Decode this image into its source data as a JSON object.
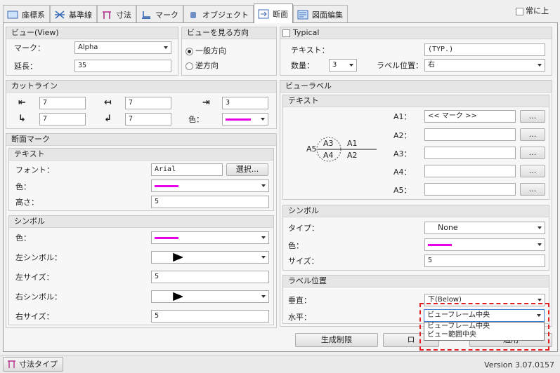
{
  "tabs": [
    {
      "label": "座標系",
      "icon": "coordinate-icon"
    },
    {
      "label": "基準線",
      "icon": "grid-icon"
    },
    {
      "label": "寸法",
      "icon": "dimension-icon"
    },
    {
      "label": "マーク",
      "icon": "mark-icon"
    },
    {
      "label": "オブジェクト",
      "icon": "object-icon"
    },
    {
      "label": "断面",
      "icon": "section-icon"
    },
    {
      "label": "図面編集",
      "icon": "drawing-edit-icon"
    }
  ],
  "always_on_top": "常に上",
  "view": {
    "title": "ビュー(View)",
    "mark_label": "マーク：",
    "mark_value": "Alpha",
    "extend_label": "延長：",
    "extend_value": "35"
  },
  "direction": {
    "title": "ビューを見る方向",
    "opt1": "一般方向",
    "opt2": "逆方向"
  },
  "typical": {
    "title": "Typical",
    "text_label": "テキスト：",
    "text_value": "(TYP.)",
    "qty_label": "数量：",
    "qty_value": "3",
    "pos_label": "ラベル位置：",
    "pos_value": "右"
  },
  "cutline": {
    "title": "カットライン",
    "v1": "7",
    "v2": "7",
    "v3": "3",
    "v4": "7",
    "v5": "7",
    "color_label": "色："
  },
  "section_mark": {
    "title": "断面マーク",
    "text_group": "テキスト",
    "font_label": "フォント：",
    "font_value": "Arial",
    "select_button": "選択...",
    "color_label": "色：",
    "height_label": "高さ：",
    "height_value": "5",
    "symbol_group": "シンボル",
    "sym_color_label": "色：",
    "left_symbol_label": "左シンボル：",
    "left_size_label": "左サイズ：",
    "left_size_value": "5",
    "right_symbol_label": "右シンボル：",
    "right_size_label": "右サイズ：",
    "right_size_value": "5"
  },
  "view_label": {
    "title": "ビューラベル",
    "text_group": "テキスト",
    "diagram": {
      "a5": "A5",
      "a3": "A3",
      "a4": "A4",
      "a1": "A1",
      "a2": "A2"
    },
    "rows": [
      {
        "label": "A1：",
        "value": "<< マーク >>",
        "button": "..."
      },
      {
        "label": "A2：",
        "value": "",
        "button": "..."
      },
      {
        "label": "A3：",
        "value": "",
        "button": "..."
      },
      {
        "label": "A4：",
        "value": "",
        "button": "..."
      },
      {
        "label": "A5：",
        "value": "",
        "button": "..."
      }
    ],
    "symbol_group": "シンボル",
    "type_label": "タイプ：",
    "type_value": "None",
    "color_label": "色：",
    "size_label": "サイズ：",
    "size_value": "5",
    "label_pos_group": "ラベル位置",
    "vertical_label": "垂直：",
    "vertical_value": "下(Below)",
    "horizontal_label": "水平：",
    "horizontal_value": "ビューフレーム中央",
    "dropdown_options": [
      "ビューフレーム中央",
      "ビュー範囲中央"
    ]
  },
  "buttons": {
    "generate": "生成制限",
    "b2": "ロ",
    "apply": "適用"
  },
  "status": {
    "dim_type": "寸法タイプ",
    "version": "Version 3.07.0157"
  },
  "colors": {
    "accent": "#e800e8",
    "highlight": "#e02020"
  }
}
